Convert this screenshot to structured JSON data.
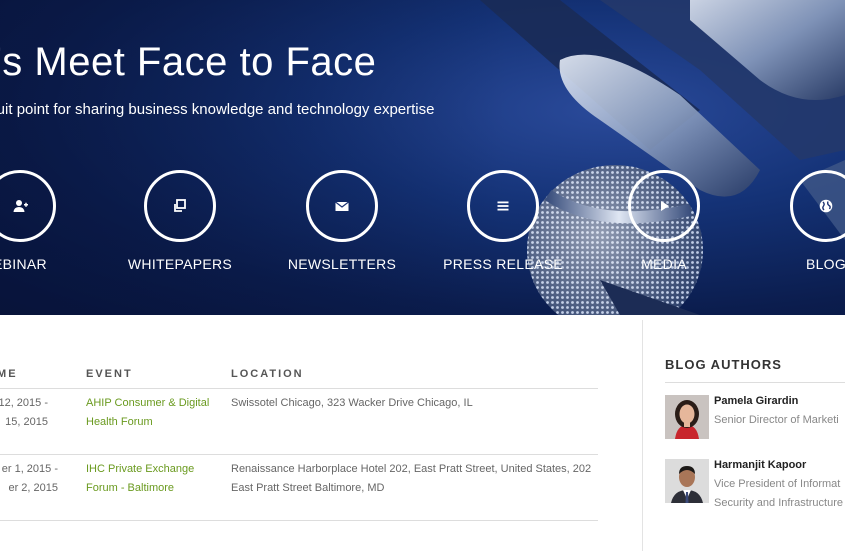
{
  "hero": {
    "title": "t’s Meet Face to Face",
    "subtitle": "nduit point for sharing business knowledge and technology expertise",
    "categories": [
      {
        "label": "EBINAR",
        "icon": "add-user-icon"
      },
      {
        "label": "WHITEPAPERS",
        "icon": "copy-icon"
      },
      {
        "label": "NEWSLETTERS",
        "icon": "envelope-icon"
      },
      {
        "label": "PRESS RELEASE",
        "icon": "list-icon"
      },
      {
        "label": "MEDIA",
        "icon": "play-icon"
      },
      {
        "label": "BLOG",
        "icon": "globe-icon"
      }
    ]
  },
  "events": {
    "headers": {
      "time": "IME",
      "event": "EVENT",
      "location": "LOCATION"
    },
    "rows": [
      {
        "time1": "12, 2015 -",
        "time2": "15, 2015",
        "event": "AHIP Consumer & Digital Health Forum",
        "location": "Swissotel Chicago, 323 Wacker Drive Chicago, IL"
      },
      {
        "time1": "er 1, 2015 -",
        "time2": "er 2, 2015",
        "event": "IHC Private Exchange Forum - Baltimore",
        "location": "Renaissance Harborplace Hotel 202, East Pratt Street, United States, 202 East Pratt Street Baltimore, MD"
      }
    ]
  },
  "blog_authors": {
    "title": "BLOG AUTHORS",
    "authors": [
      {
        "name": "Pamela Girardin",
        "role": "Senior Director of Marketi"
      },
      {
        "name": "Harmanjit Kapoor",
        "role": "Vice President of Informat Security and Infrastructure"
      }
    ]
  },
  "colors": {
    "hero_bg": "#0b1d4e",
    "link_green": "#6a9a1f",
    "text_gray": "#666666"
  }
}
